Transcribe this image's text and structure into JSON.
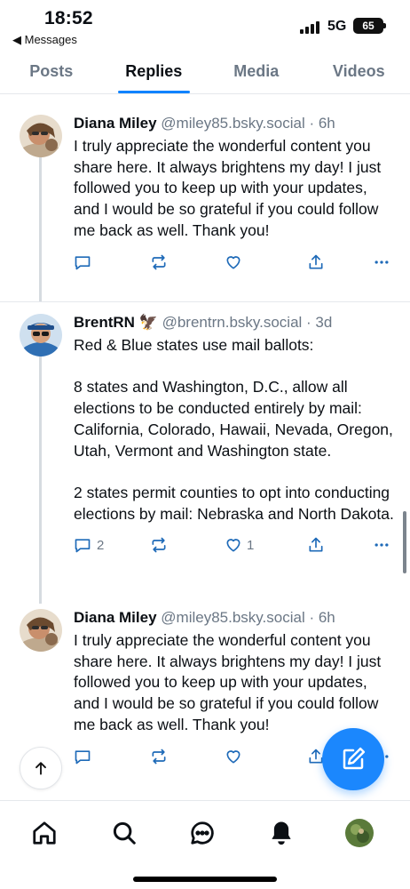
{
  "status_bar": {
    "time": "18:52",
    "back_app": "◀ Messages",
    "network": "5G",
    "battery": "65"
  },
  "tabs": [
    {
      "label": "Posts",
      "active": false
    },
    {
      "label": "Replies",
      "active": true
    },
    {
      "label": "Media",
      "active": false
    },
    {
      "label": "Videos",
      "active": false
    }
  ],
  "posts": [
    {
      "name": "Diana Miley",
      "handle": "@miley85.bsky.social · 6h",
      "text": "I truly appreciate the wonderful content you share here. It always brightens my day! I just followed you to keep up with your updates, and I would be so grateful if you could follow me back as well. Thank you!",
      "reply_count": "",
      "like_count": ""
    },
    {
      "name": "BrentRN",
      "name_emoji": "🦅",
      "handle": "@brentrn.bsky.social · 3d",
      "text": "Red & Blue states use mail ballots:\n\n8 states and Washington, D.C., allow all elections to be conducted entirely by mail: California, Colorado, Hawaii, Nevada, Oregon, Utah, Vermont and Washington state.\n\n2 states permit counties to opt into conducting elections by mail: Nebraska and North Dakota.",
      "reply_count": "2",
      "like_count": "1"
    },
    {
      "name": "Diana Miley",
      "handle": "@miley85.bsky.social · 6h",
      "text": "I truly appreciate the wonderful content you share here. It always brightens my day! I just followed you to keep up with your updates, and I would be so grateful if you could follow me back as well. Thank you!",
      "reply_count": "",
      "like_count": ""
    }
  ],
  "icons": {
    "reply": "reply-icon",
    "repost": "repost-icon",
    "like": "heart-icon",
    "share": "share-icon",
    "more": "more-icon"
  },
  "bottom_nav": [
    "home-icon",
    "search-icon",
    "chat-icon",
    "bell-icon",
    "profile-avatar"
  ],
  "colors": {
    "accent": "#1083fe",
    "muted": "#6b7785",
    "text": "#0b0f14"
  }
}
